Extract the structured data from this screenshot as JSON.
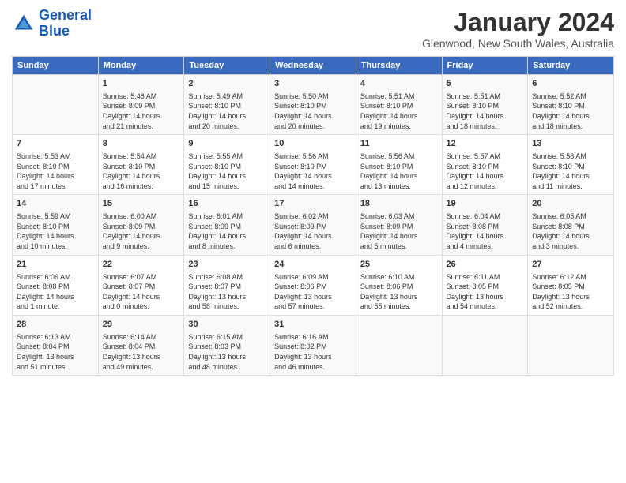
{
  "header": {
    "logo_line1": "General",
    "logo_line2": "Blue",
    "title": "January 2024",
    "subtitle": "Glenwood, New South Wales, Australia"
  },
  "days": [
    "Sunday",
    "Monday",
    "Tuesday",
    "Wednesday",
    "Thursday",
    "Friday",
    "Saturday"
  ],
  "weeks": [
    [
      {
        "date": "",
        "content": ""
      },
      {
        "date": "1",
        "content": "Sunrise: 5:48 AM\nSunset: 8:09 PM\nDaylight: 14 hours\nand 21 minutes."
      },
      {
        "date": "2",
        "content": "Sunrise: 5:49 AM\nSunset: 8:10 PM\nDaylight: 14 hours\nand 20 minutes."
      },
      {
        "date": "3",
        "content": "Sunrise: 5:50 AM\nSunset: 8:10 PM\nDaylight: 14 hours\nand 20 minutes."
      },
      {
        "date": "4",
        "content": "Sunrise: 5:51 AM\nSunset: 8:10 PM\nDaylight: 14 hours\nand 19 minutes."
      },
      {
        "date": "5",
        "content": "Sunrise: 5:51 AM\nSunset: 8:10 PM\nDaylight: 14 hours\nand 18 minutes."
      },
      {
        "date": "6",
        "content": "Sunrise: 5:52 AM\nSunset: 8:10 PM\nDaylight: 14 hours\nand 18 minutes."
      }
    ],
    [
      {
        "date": "7",
        "content": "Sunrise: 5:53 AM\nSunset: 8:10 PM\nDaylight: 14 hours\nand 17 minutes."
      },
      {
        "date": "8",
        "content": "Sunrise: 5:54 AM\nSunset: 8:10 PM\nDaylight: 14 hours\nand 16 minutes."
      },
      {
        "date": "9",
        "content": "Sunrise: 5:55 AM\nSunset: 8:10 PM\nDaylight: 14 hours\nand 15 minutes."
      },
      {
        "date": "10",
        "content": "Sunrise: 5:56 AM\nSunset: 8:10 PM\nDaylight: 14 hours\nand 14 minutes."
      },
      {
        "date": "11",
        "content": "Sunrise: 5:56 AM\nSunset: 8:10 PM\nDaylight: 14 hours\nand 13 minutes."
      },
      {
        "date": "12",
        "content": "Sunrise: 5:57 AM\nSunset: 8:10 PM\nDaylight: 14 hours\nand 12 minutes."
      },
      {
        "date": "13",
        "content": "Sunrise: 5:58 AM\nSunset: 8:10 PM\nDaylight: 14 hours\nand 11 minutes."
      }
    ],
    [
      {
        "date": "14",
        "content": "Sunrise: 5:59 AM\nSunset: 8:10 PM\nDaylight: 14 hours\nand 10 minutes."
      },
      {
        "date": "15",
        "content": "Sunrise: 6:00 AM\nSunset: 8:09 PM\nDaylight: 14 hours\nand 9 minutes."
      },
      {
        "date": "16",
        "content": "Sunrise: 6:01 AM\nSunset: 8:09 PM\nDaylight: 14 hours\nand 8 minutes."
      },
      {
        "date": "17",
        "content": "Sunrise: 6:02 AM\nSunset: 8:09 PM\nDaylight: 14 hours\nand 6 minutes."
      },
      {
        "date": "18",
        "content": "Sunrise: 6:03 AM\nSunset: 8:09 PM\nDaylight: 14 hours\nand 5 minutes."
      },
      {
        "date": "19",
        "content": "Sunrise: 6:04 AM\nSunset: 8:08 PM\nDaylight: 14 hours\nand 4 minutes."
      },
      {
        "date": "20",
        "content": "Sunrise: 6:05 AM\nSunset: 8:08 PM\nDaylight: 14 hours\nand 3 minutes."
      }
    ],
    [
      {
        "date": "21",
        "content": "Sunrise: 6:06 AM\nSunset: 8:08 PM\nDaylight: 14 hours\nand 1 minute."
      },
      {
        "date": "22",
        "content": "Sunrise: 6:07 AM\nSunset: 8:07 PM\nDaylight: 14 hours\nand 0 minutes."
      },
      {
        "date": "23",
        "content": "Sunrise: 6:08 AM\nSunset: 8:07 PM\nDaylight: 13 hours\nand 58 minutes."
      },
      {
        "date": "24",
        "content": "Sunrise: 6:09 AM\nSunset: 8:06 PM\nDaylight: 13 hours\nand 57 minutes."
      },
      {
        "date": "25",
        "content": "Sunrise: 6:10 AM\nSunset: 8:06 PM\nDaylight: 13 hours\nand 55 minutes."
      },
      {
        "date": "26",
        "content": "Sunrise: 6:11 AM\nSunset: 8:05 PM\nDaylight: 13 hours\nand 54 minutes."
      },
      {
        "date": "27",
        "content": "Sunrise: 6:12 AM\nSunset: 8:05 PM\nDaylight: 13 hours\nand 52 minutes."
      }
    ],
    [
      {
        "date": "28",
        "content": "Sunrise: 6:13 AM\nSunset: 8:04 PM\nDaylight: 13 hours\nand 51 minutes."
      },
      {
        "date": "29",
        "content": "Sunrise: 6:14 AM\nSunset: 8:04 PM\nDaylight: 13 hours\nand 49 minutes."
      },
      {
        "date": "30",
        "content": "Sunrise: 6:15 AM\nSunset: 8:03 PM\nDaylight: 13 hours\nand 48 minutes."
      },
      {
        "date": "31",
        "content": "Sunrise: 6:16 AM\nSunset: 8:02 PM\nDaylight: 13 hours\nand 46 minutes."
      },
      {
        "date": "",
        "content": ""
      },
      {
        "date": "",
        "content": ""
      },
      {
        "date": "",
        "content": ""
      }
    ]
  ]
}
